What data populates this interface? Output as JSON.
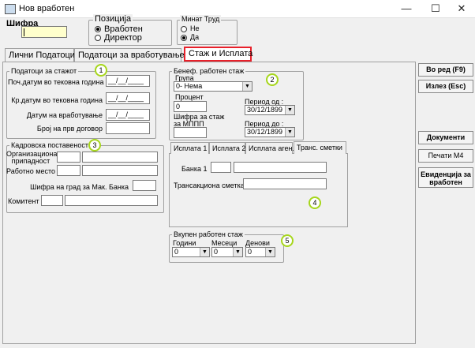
{
  "window": {
    "title": "Нов вработен"
  },
  "header": {
    "sifra_label": "Шифра",
    "pozicija": {
      "label": "Позиција",
      "opt1": "Вработен",
      "opt2": "Директор"
    },
    "minat": {
      "label": "Минат Труд",
      "opt1": "Не",
      "opt2": "Да"
    }
  },
  "tabs": {
    "t1": "Лични Податоци",
    "t2": "Податоци за вработување",
    "t3": "Стаж и Исплата"
  },
  "staz": {
    "label": "Податоци за стажот",
    "poc": "Поч.датум во тековна година",
    "kr": "Кр.датум во тековна година",
    "vrab": "Датум на вработување",
    "broj": "Број на прв договор",
    "date_value": "__/__/____"
  },
  "benef": {
    "label": "Бенеф. работен стаж",
    "grupa": "Група",
    "grupa_value": "0- Нема",
    "procent": "Процент",
    "procent_value": "0",
    "sifra": "Шифра за стаж за МППП",
    "period_od": "Период од :",
    "period_do": "Период до :",
    "od_value": "30/12/1899",
    "do_value": "30/12/1899"
  },
  "kadr": {
    "label": "Кадровска поставеност",
    "org": "Организациона припадност",
    "rab": "Работно место",
    "grad": "Шифра на град за Мак. Банка",
    "komitent": "Комитент"
  },
  "isplata": {
    "tab1": "Исплата 1",
    "tab2": "Исплата 2",
    "tab3": "Исплата аген.",
    "tab4": "Транс. сметки",
    "banka": "Банка 1",
    "trans": "Трансакциона сметка"
  },
  "vkupen": {
    "label": "Вкупен работен стаж",
    "godini": "Години",
    "meseci": "Месеци",
    "denovi": "Денови",
    "godini_value": "0",
    "meseci_value": "0",
    "denovi_value": "0"
  },
  "side": {
    "vo_red": "Во ред (F9)",
    "izlez": "Излез (Esc)",
    "dokumenti": "Документи",
    "pecati": "Печати М4",
    "evidencija": "Евиденција за вработен"
  },
  "badges": [
    "1",
    "2",
    "3",
    "4",
    "5"
  ],
  "colors": {
    "highlight": "#e8202a",
    "badge": "#a6d61b",
    "sifra_bg": "#ffffcc"
  }
}
